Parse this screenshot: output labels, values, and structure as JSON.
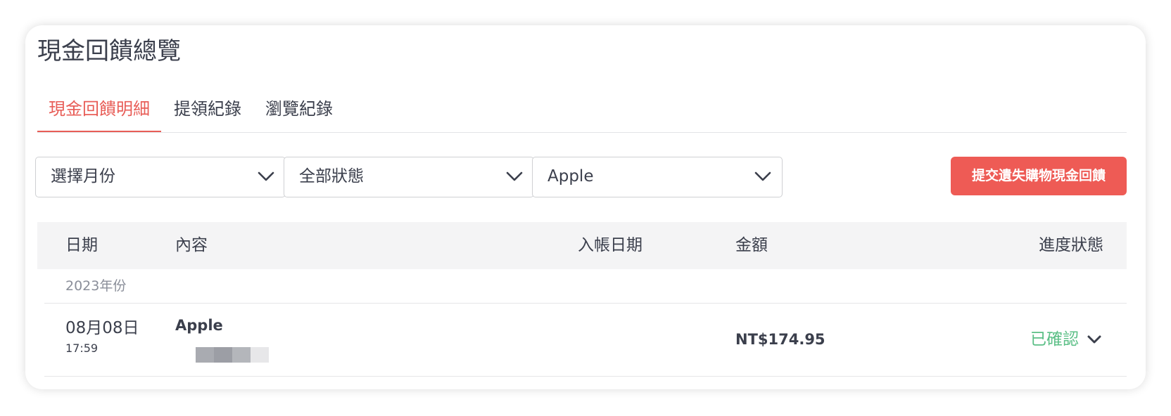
{
  "page": {
    "title": "現金回饋總覽"
  },
  "tabs": [
    {
      "label": "現金回饋明細",
      "active": true
    },
    {
      "label": "提領紀錄",
      "active": false
    },
    {
      "label": "瀏覽紀錄",
      "active": false
    }
  ],
  "filters": {
    "month": {
      "value": "選擇月份"
    },
    "status": {
      "value": "全部狀態"
    },
    "merchant": {
      "value": "Apple"
    }
  },
  "actions": {
    "submit_missing_label": "提交遺失購物現金回饋"
  },
  "table": {
    "headers": {
      "date": "日期",
      "content": "內容",
      "posting_date": "入帳日期",
      "amount": "金額",
      "status": "進度狀態"
    },
    "year_group": "2023年份",
    "rows": [
      {
        "date": "08月08日",
        "time": "17:59",
        "merchant": "Apple",
        "posting_date": "",
        "amount": "NT$174.95",
        "status": "已確認"
      }
    ]
  },
  "colors": {
    "accent": "#e85d57",
    "button": "#ee5b55",
    "status_confirmed": "#5bbf86",
    "text": "#3b3f4c",
    "muted": "#8a8e99"
  },
  "icons": {
    "dropdown": "chevron-down-icon",
    "expand": "chevron-down-icon"
  }
}
